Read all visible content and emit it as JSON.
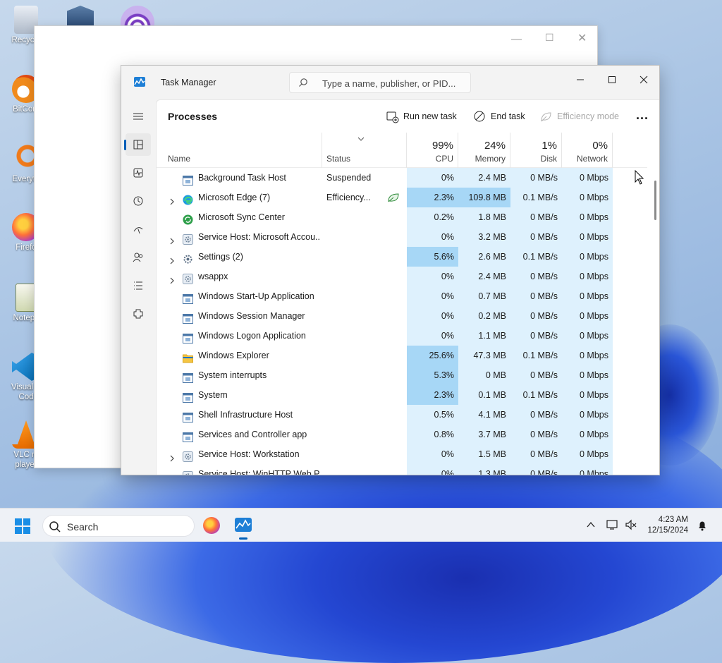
{
  "desktop": {
    "icons": [
      {
        "label": "Recycle",
        "icon": "recycle-bin-icon"
      },
      {
        "label": "BitCom",
        "icon": "bitcomet-icon"
      },
      {
        "label": "Everyth",
        "icon": "everything-search-icon"
      },
      {
        "label": "Firefo",
        "icon": "firefox-icon"
      },
      {
        "label": "Notepa",
        "icon": "notepad-icon"
      },
      {
        "label": "Visual S Cod",
        "icon": "vscode-icon"
      },
      {
        "label": "VLC m player",
        "icon": "vlc-icon"
      }
    ]
  },
  "window": {
    "title": "Task Manager",
    "search_placeholder": "Type a name, publisher, or PID..."
  },
  "nav": [
    "processes-icon",
    "performance-icon",
    "app-history-icon",
    "startup-apps-icon",
    "users-icon",
    "details-icon",
    "services-icon",
    "settings-icon"
  ],
  "toolbar": {
    "title": "Processes",
    "run_new_task": "Run new task",
    "end_task": "End task",
    "efficiency_mode": "Efficiency mode",
    "more": "..."
  },
  "columns": {
    "name": "Name",
    "status": "Status",
    "cpu_pct": "99%",
    "cpu": "CPU",
    "memory_pct": "24%",
    "memory": "Memory",
    "disk_pct": "1%",
    "disk": "Disk",
    "network_pct": "0%",
    "network": "Network"
  },
  "processes": [
    {
      "name": "Background Task Host",
      "status": "Suspended",
      "cpu": "0%",
      "memory": "2.4 MB",
      "disk": "0 MB/s",
      "network": "0 Mbps",
      "expandable": false,
      "icon": "window-icon"
    },
    {
      "name": "Microsoft Edge (7)",
      "status": "Efficiency...",
      "cpu": "2.3%",
      "memory": "109.8 MB",
      "disk": "0.1 MB/s",
      "network": "0 Mbps",
      "expandable": true,
      "icon": "edge-icon"
    },
    {
      "name": "Microsoft Sync Center",
      "status": "",
      "cpu": "0.2%",
      "memory": "1.8 MB",
      "disk": "0 MB/s",
      "network": "0 Mbps",
      "expandable": false,
      "icon": "sync-icon"
    },
    {
      "name": "Service Host: Microsoft Accou...",
      "status": "",
      "cpu": "0%",
      "memory": "3.2 MB",
      "disk": "0 MB/s",
      "network": "0 Mbps",
      "expandable": true,
      "icon": "gear-icon"
    },
    {
      "name": "Settings (2)",
      "status": "",
      "cpu": "5.6%",
      "memory": "2.6 MB",
      "disk": "0.1 MB/s",
      "network": "0 Mbps",
      "expandable": true,
      "icon": "settings-app-icon"
    },
    {
      "name": "wsappx",
      "status": "",
      "cpu": "0%",
      "memory": "2.4 MB",
      "disk": "0 MB/s",
      "network": "0 Mbps",
      "expandable": true,
      "icon": "gear-icon"
    },
    {
      "name": "Windows Start-Up Application",
      "status": "",
      "cpu": "0%",
      "memory": "0.7 MB",
      "disk": "0 MB/s",
      "network": "0 Mbps",
      "expandable": false,
      "icon": "window-icon"
    },
    {
      "name": "Windows Session Manager",
      "status": "",
      "cpu": "0%",
      "memory": "0.2 MB",
      "disk": "0 MB/s",
      "network": "0 Mbps",
      "expandable": false,
      "icon": "window-icon"
    },
    {
      "name": "Windows Logon Application",
      "status": "",
      "cpu": "0%",
      "memory": "1.1 MB",
      "disk": "0 MB/s",
      "network": "0 Mbps",
      "expandable": false,
      "icon": "window-icon"
    },
    {
      "name": "Windows Explorer",
      "status": "",
      "cpu": "25.6%",
      "memory": "47.3 MB",
      "disk": "0.1 MB/s",
      "network": "0 Mbps",
      "expandable": false,
      "icon": "folder-icon"
    },
    {
      "name": "System interrupts",
      "status": "",
      "cpu": "5.3%",
      "memory": "0 MB",
      "disk": "0 MB/s",
      "network": "0 Mbps",
      "expandable": false,
      "icon": "window-icon"
    },
    {
      "name": "System",
      "status": "",
      "cpu": "2.3%",
      "memory": "0.1 MB",
      "disk": "0.1 MB/s",
      "network": "0 Mbps",
      "expandable": false,
      "icon": "window-icon"
    },
    {
      "name": "Shell Infrastructure Host",
      "status": "",
      "cpu": "0.5%",
      "memory": "4.1 MB",
      "disk": "0 MB/s",
      "network": "0 Mbps",
      "expandable": false,
      "icon": "window-icon"
    },
    {
      "name": "Services and Controller app",
      "status": "",
      "cpu": "0.8%",
      "memory": "3.7 MB",
      "disk": "0 MB/s",
      "network": "0 Mbps",
      "expandable": false,
      "icon": "window-icon"
    },
    {
      "name": "Service Host: Workstation",
      "status": "",
      "cpu": "0%",
      "memory": "1.5 MB",
      "disk": "0 MB/s",
      "network": "0 Mbps",
      "expandable": true,
      "icon": "gear-icon"
    },
    {
      "name": "Service Host: WinHTTP Web P...",
      "status": "",
      "cpu": "0%",
      "memory": "1.3 MB",
      "disk": "0 MB/s",
      "network": "0 Mbps",
      "expandable": true,
      "icon": "gear-icon"
    }
  ],
  "taskbar": {
    "search_label": "Search",
    "time": "4:23 AM",
    "date": "12/15/2024"
  },
  "colors": {
    "heat_low": "#def1fd",
    "heat_high": "#a7d7f6",
    "accent": "#005fb8"
  }
}
